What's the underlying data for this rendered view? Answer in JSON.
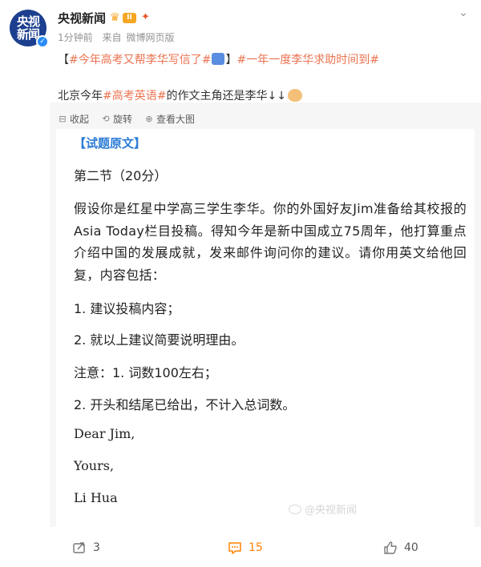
{
  "post": {
    "author": "央视新闻",
    "avatar_text": "央视新闻",
    "level": "II",
    "time": "1分钟前",
    "source_prefix": "来自",
    "source": "微博网页版",
    "topic_open": "【",
    "topic1": "#今年高考又帮李华写信了#",
    "topic_close": "】",
    "topic2": "#一年一度李华求助时间到#",
    "body_prefix": "北京今年",
    "body_tag": "#高考英语#",
    "body_suffix": "的作文主角还是李华↓↓"
  },
  "media_tools": {
    "collapse": "收起",
    "rotate": "旋转",
    "view_large": "查看大图"
  },
  "document": {
    "heading": "【试题原文】",
    "section": "第二节（20分）",
    "paragraph": "假设你是红星中学高三学生李华。你的外国好友Jim准备给其校报的Asia Today栏目投稿。得知今年是新中国成立75周年，他打算重点介绍中国的发展成就，发来邮件询问你的建议。请你用英文给他回复，内容包括：",
    "item1": "1. 建议投稿内容；",
    "item2": "2. 就以上建议简要说明理由。",
    "note1": "注意：1. 词数100左右；",
    "note2": "2. 开头和结尾已给出，不计入总词数。",
    "greeting": "Dear Jim,",
    "closing": "Yours,",
    "signature": "Li Hua",
    "watermark": "@央视新闻"
  },
  "actions": {
    "reposts": "3",
    "comments": "15",
    "likes": "40"
  },
  "colors": {
    "topic": "#eb7350",
    "heading": "#2a7bd5",
    "comment_active": "#ff8200",
    "media_bg": "#f6f6f6"
  }
}
